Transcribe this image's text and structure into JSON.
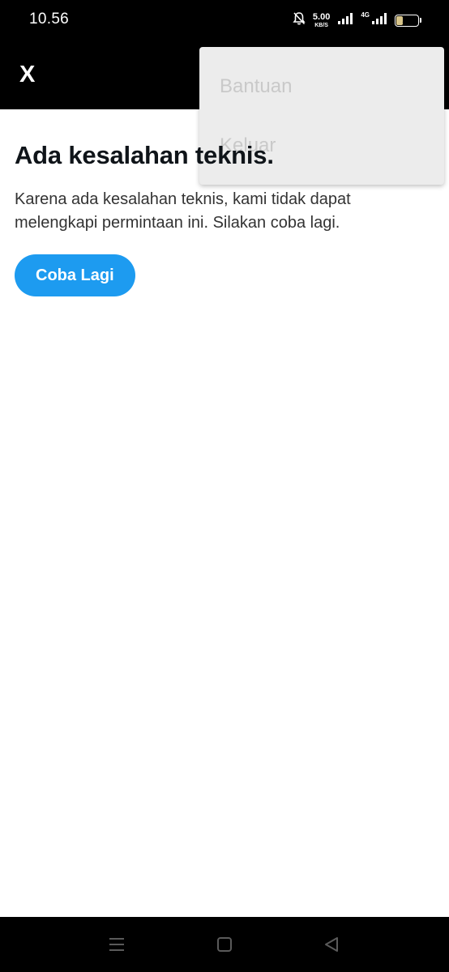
{
  "status_bar": {
    "time": "10.56",
    "net_speed_value": "5.00",
    "net_speed_unit": "KB/S",
    "network_type": "4G",
    "battery_level": "27",
    "battery_fraction": 0.27,
    "icons": [
      "bell-muted-icon",
      "signal-icon",
      "signal-4g-icon",
      "battery-icon"
    ]
  },
  "app_bar": {
    "logo": "X",
    "overflow_icon": "more-vertical-icon"
  },
  "menu": {
    "items": [
      {
        "label": "Bantuan"
      },
      {
        "label": "Keluar"
      }
    ]
  },
  "error": {
    "title": "Ada kesalahan teknis.",
    "message": "Karena ada kesalahan teknis, kami tidak dapat melengkapi permintaan ini. Silakan coba lagi.",
    "retry_label": "Coba Lagi"
  },
  "nav_bar": {
    "icons": [
      "recent-apps-icon",
      "home-icon",
      "back-icon"
    ]
  },
  "colors": {
    "accent": "#1d9bf0",
    "bar_background": "#000000",
    "menu_background": "#ececec",
    "title_text": "#0f1419"
  }
}
